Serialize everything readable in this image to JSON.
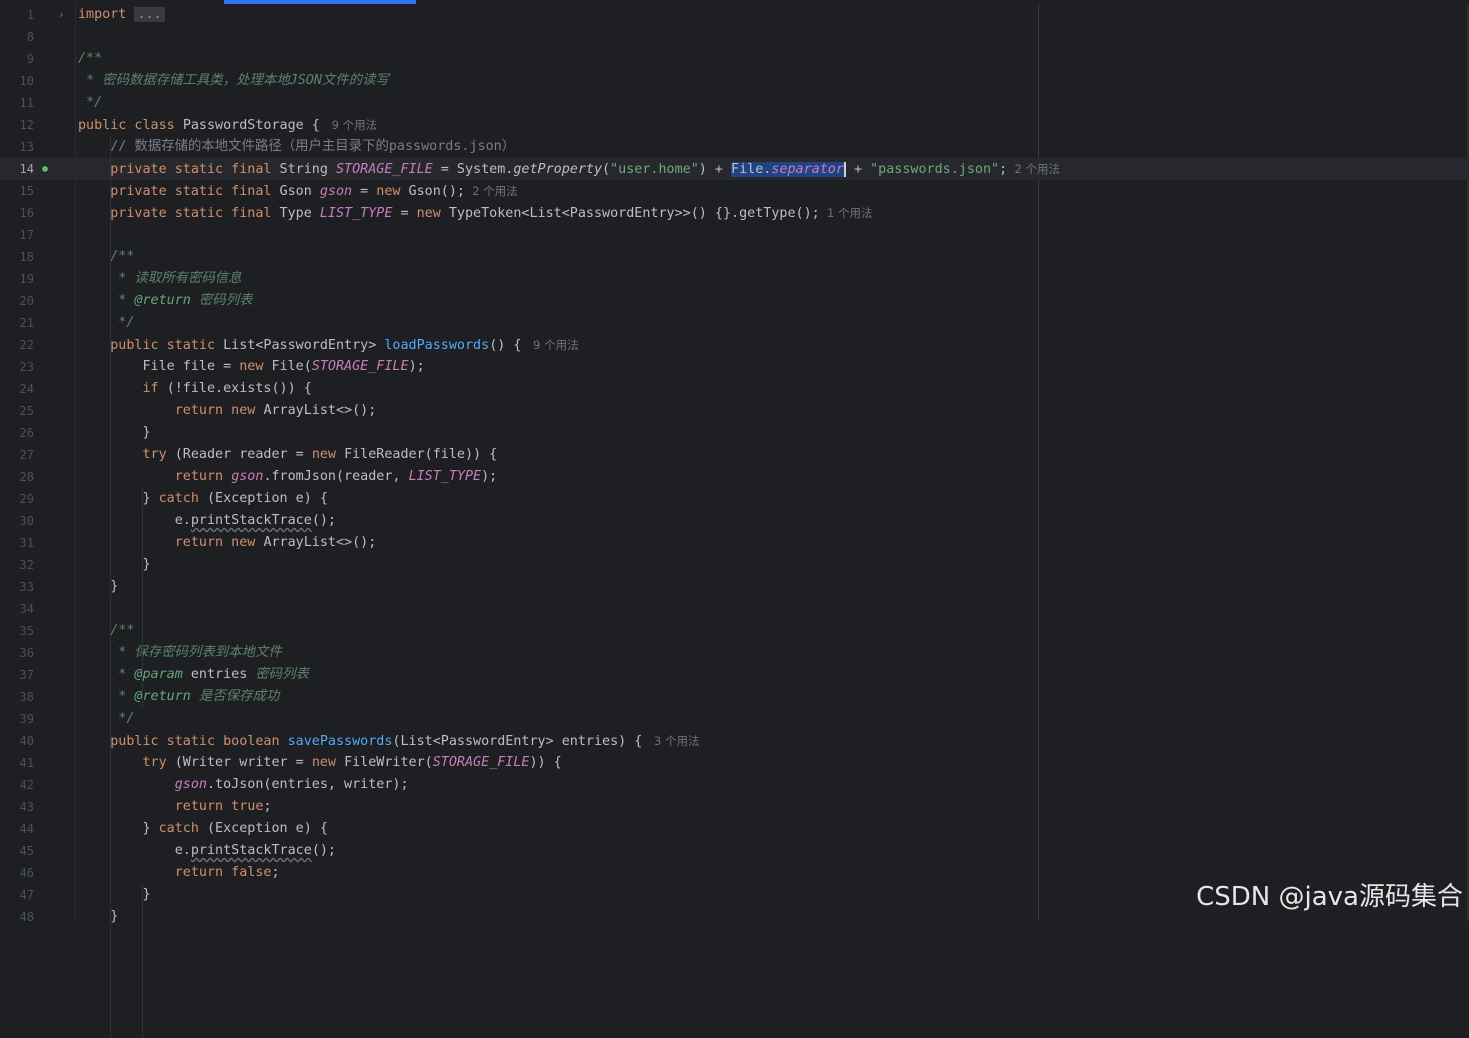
{
  "lines": [
    {
      "n": "1",
      "parts": [
        [
          "kw",
          "import"
        ],
        [
          "",
          ""
        ],
        [
          "fold-chip",
          "..."
        ]
      ],
      "fold": "›"
    },
    {
      "n": "8",
      "parts": []
    },
    {
      "n": "9",
      "parts": [
        [
          "doc",
          "/**"
        ]
      ]
    },
    {
      "n": "10",
      "parts": [
        [
          "doc",
          " * 密码数据存储工具类，处理本地JSON文件的读写"
        ]
      ]
    },
    {
      "n": "11",
      "parts": [
        [
          "doc",
          " */"
        ]
      ]
    },
    {
      "n": "12",
      "parts": [
        [
          "kw",
          "public class "
        ],
        [
          "",
          "PasswordStorage { "
        ],
        [
          "hint",
          " 9 个用法"
        ]
      ]
    },
    {
      "n": "13",
      "parts": [
        [
          "cmt",
          "    // 数据存储的本地文件路径（用户主目录下的passwords.json）"
        ]
      ]
    },
    {
      "n": "14",
      "current": true,
      "parts": [
        [
          "kw",
          "    private static final "
        ],
        [
          "",
          "String "
        ],
        [
          "fld",
          "STORAGE_FILE"
        ],
        [
          "",
          " = System."
        ],
        [
          "ital",
          "getProperty"
        ],
        [
          "",
          "("
        ],
        [
          "str",
          "\"user.home\""
        ],
        [
          "",
          ") + "
        ],
        [
          "sel",
          "File."
        ],
        [
          "sel fldi caret",
          "separator"
        ],
        [
          "",
          " + "
        ],
        [
          "str",
          "\"passwords.json\""
        ],
        [
          "",
          ";"
        ],
        [
          "hint",
          "  2 个用法"
        ]
      ]
    },
    {
      "n": "15",
      "parts": [
        [
          "kw",
          "    private static final "
        ],
        [
          "",
          "Gson "
        ],
        [
          "fld",
          "gson"
        ],
        [
          "",
          " = "
        ],
        [
          "kw",
          "new "
        ],
        [
          "",
          "Gson();"
        ],
        [
          "hint",
          "  2 个用法"
        ]
      ]
    },
    {
      "n": "16",
      "parts": [
        [
          "kw",
          "    private static final "
        ],
        [
          "",
          "Type "
        ],
        [
          "fld",
          "LIST_TYPE"
        ],
        [
          "",
          " = "
        ],
        [
          "kw",
          "new "
        ],
        [
          "",
          "TypeToken<List<PasswordEntry>>() {}.getType();"
        ],
        [
          "hint",
          "  1 个用法"
        ]
      ]
    },
    {
      "n": "17",
      "parts": []
    },
    {
      "n": "18",
      "parts": [
        [
          "doc",
          "    /**"
        ]
      ]
    },
    {
      "n": "19",
      "parts": [
        [
          "doc",
          "     * 读取所有密码信息"
        ]
      ]
    },
    {
      "n": "20",
      "parts": [
        [
          "doc",
          "     * "
        ],
        [
          "tag",
          "@return"
        ],
        [
          "doc",
          " 密码列表"
        ]
      ]
    },
    {
      "n": "21",
      "parts": [
        [
          "doc",
          "     */"
        ]
      ]
    },
    {
      "n": "22",
      "parts": [
        [
          "kw",
          "    public static "
        ],
        [
          "",
          "List<PasswordEntry> "
        ],
        [
          "mth",
          "loadPasswords"
        ],
        [
          "",
          "() { "
        ],
        [
          "hint",
          " 9 个用法"
        ]
      ]
    },
    {
      "n": "23",
      "parts": [
        [
          "",
          "        File file = "
        ],
        [
          "kw",
          "new "
        ],
        [
          "",
          "File("
        ],
        [
          "fld",
          "STORAGE_FILE"
        ],
        [
          "",
          ");"
        ]
      ]
    },
    {
      "n": "24",
      "parts": [
        [
          "kw",
          "        if "
        ],
        [
          "",
          "(!file.exists()) {"
        ]
      ]
    },
    {
      "n": "25",
      "parts": [
        [
          "kw",
          "            return new "
        ],
        [
          "",
          "ArrayList<>();"
        ]
      ]
    },
    {
      "n": "26",
      "parts": [
        [
          "",
          "        }"
        ]
      ]
    },
    {
      "n": "27",
      "parts": [
        [
          "kw",
          "        try "
        ],
        [
          "",
          "(Reader reader = "
        ],
        [
          "kw",
          "new "
        ],
        [
          "",
          "FileReader(file)) {"
        ]
      ]
    },
    {
      "n": "28",
      "parts": [
        [
          "kw",
          "            return "
        ],
        [
          "fld",
          "gson"
        ],
        [
          "",
          ".fromJson(reader, "
        ],
        [
          "fld",
          "LIST_TYPE"
        ],
        [
          "",
          ");"
        ]
      ]
    },
    {
      "n": "29",
      "parts": [
        [
          "",
          "        } "
        ],
        [
          "kw",
          "catch "
        ],
        [
          "",
          "(Exception e) {"
        ]
      ]
    },
    {
      "n": "30",
      "parts": [
        [
          "",
          "            e."
        ],
        [
          "wavy",
          "printStackTrace"
        ],
        [
          "",
          "();"
        ]
      ]
    },
    {
      "n": "31",
      "parts": [
        [
          "kw",
          "            return new "
        ],
        [
          "",
          "ArrayList<>();"
        ]
      ]
    },
    {
      "n": "32",
      "parts": [
        [
          "",
          "        }"
        ]
      ]
    },
    {
      "n": "33",
      "parts": [
        [
          "",
          "    }"
        ]
      ]
    },
    {
      "n": "34",
      "parts": []
    },
    {
      "n": "35",
      "parts": [
        [
          "doc",
          "    /**"
        ]
      ]
    },
    {
      "n": "36",
      "parts": [
        [
          "doc",
          "     * 保存密码列表到本地文件"
        ]
      ]
    },
    {
      "n": "37",
      "parts": [
        [
          "doc",
          "     * "
        ],
        [
          "tag",
          "@param "
        ],
        [
          "",
          "entries"
        ],
        [
          "doc",
          " 密码列表"
        ]
      ]
    },
    {
      "n": "38",
      "parts": [
        [
          "doc",
          "     * "
        ],
        [
          "tag",
          "@return"
        ],
        [
          "doc",
          " 是否保存成功"
        ]
      ]
    },
    {
      "n": "39",
      "parts": [
        [
          "doc",
          "     */"
        ]
      ]
    },
    {
      "n": "40",
      "parts": [
        [
          "kw",
          "    public static boolean "
        ],
        [
          "mth",
          "savePasswords"
        ],
        [
          "",
          "(List<PasswordEntry> entries) { "
        ],
        [
          "hint",
          " 3 个用法"
        ]
      ]
    },
    {
      "n": "41",
      "parts": [
        [
          "kw",
          "        try "
        ],
        [
          "",
          "(Writer writer = "
        ],
        [
          "kw",
          "new "
        ],
        [
          "",
          "FileWriter("
        ],
        [
          "fld",
          "STORAGE_FILE"
        ],
        [
          "",
          ")) {"
        ]
      ]
    },
    {
      "n": "42",
      "parts": [
        [
          "fld",
          "            gson"
        ],
        [
          "",
          ".toJson(entries, writer);"
        ]
      ]
    },
    {
      "n": "43",
      "parts": [
        [
          "kw",
          "            return true"
        ],
        [
          "",
          ";"
        ]
      ]
    },
    {
      "n": "44",
      "parts": [
        [
          "",
          "        } "
        ],
        [
          "kw",
          "catch "
        ],
        [
          "",
          "(Exception e) {"
        ]
      ]
    },
    {
      "n": "45",
      "parts": [
        [
          "",
          "            e."
        ],
        [
          "wavy",
          "printStackTrace"
        ],
        [
          "",
          "();"
        ]
      ]
    },
    {
      "n": "46",
      "parts": [
        [
          "kw",
          "            return false"
        ],
        [
          "",
          ";"
        ]
      ]
    },
    {
      "n": "47",
      "parts": [
        [
          "",
          "        }"
        ]
      ]
    },
    {
      "n": "48",
      "parts": [
        [
          "",
          "    }"
        ]
      ]
    }
  ],
  "watermark": "CSDN @java源码集合",
  "colors": {
    "background": "#1e1f22",
    "keyword": "#cf8e6d",
    "string": "#6aab73",
    "field": "#c77dbb",
    "method": "#56a8f5",
    "selection": "#214283",
    "accent": "#3574f0"
  }
}
